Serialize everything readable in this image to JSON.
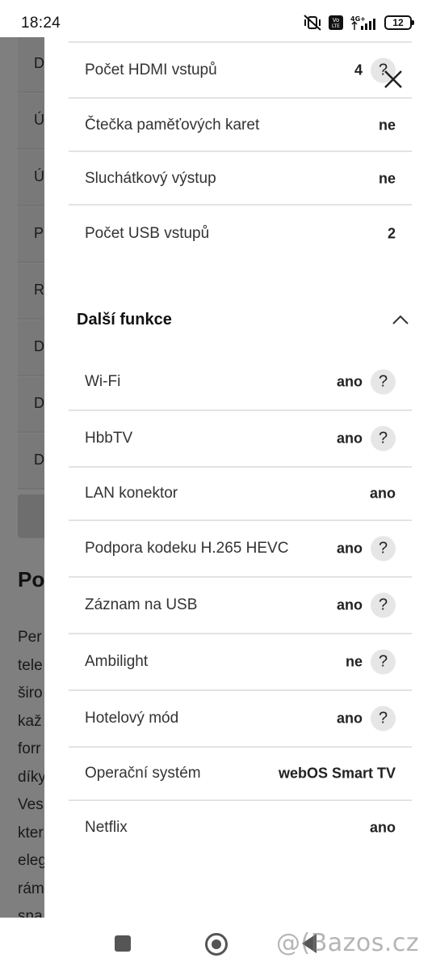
{
  "status_bar": {
    "time": "18:24",
    "network": "4G+",
    "volte": "Vo LTE",
    "battery": "12"
  },
  "background_page": {
    "row_initials": [
      "D",
      "Ú",
      "Ú",
      "P",
      "R",
      "D",
      "D",
      "D"
    ],
    "heading": "Po",
    "paragraph_fragments": [
      "Per",
      "tele",
      "širo",
      "kaž",
      "forr",
      "díky",
      "Ves",
      "kter",
      "eleg",
      "rám",
      "sna"
    ]
  },
  "panel": {
    "rows_top": [
      {
        "label": "Počet HDMI vstupů",
        "value": "4",
        "help": true
      },
      {
        "label": "Čtečka paměťových karet",
        "value": "ne",
        "help": false
      },
      {
        "label": "Sluchátkový výstup",
        "value": "ne",
        "help": false
      },
      {
        "label": "Počet USB vstupů",
        "value": "2",
        "help": false
      }
    ],
    "section": {
      "title": "Další funkce",
      "expanded": true
    },
    "rows_section": [
      {
        "label": "Wi-Fi",
        "value": "ano",
        "help": true
      },
      {
        "label": "HbbTV",
        "value": "ano",
        "help": true
      },
      {
        "label": "LAN konektor",
        "value": "ano",
        "help": false
      },
      {
        "label": "Podpora kodeku H.265 HEVC",
        "value": "ano",
        "help": true
      },
      {
        "label": "Záznam na USB",
        "value": "ano",
        "help": true
      },
      {
        "label": "Ambilight",
        "value": "ne",
        "help": true
      },
      {
        "label": "Hotelový mód",
        "value": "ano",
        "help": true
      },
      {
        "label": "Operační systém",
        "value": "webOS Smart TV",
        "help": false
      },
      {
        "label": "Netflix",
        "value": "ano",
        "help": false
      }
    ],
    "help_symbol": "?"
  },
  "watermark": "@(Bazos.cz"
}
